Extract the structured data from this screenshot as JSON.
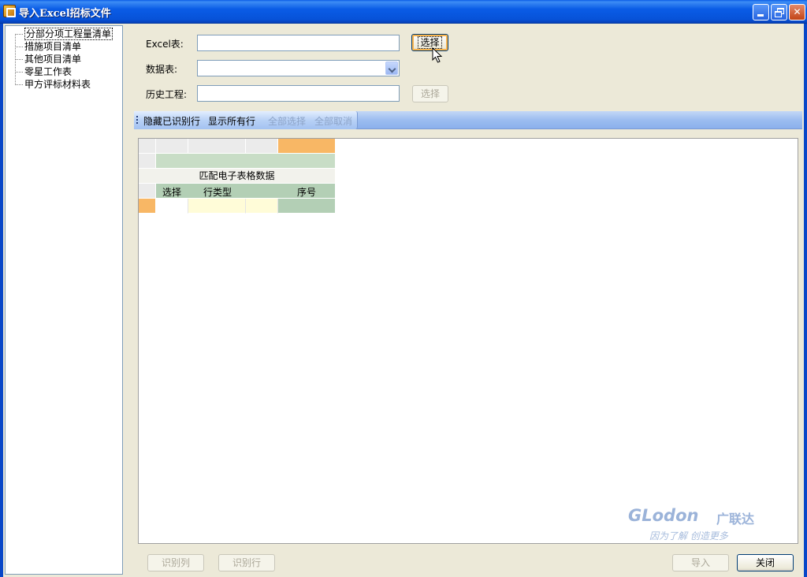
{
  "window": {
    "title": "导入Excel招标文件"
  },
  "tree": {
    "items": [
      {
        "label": "分部分项工程量清单",
        "selected": true
      },
      {
        "label": "措施项目清单"
      },
      {
        "label": "其他项目清单"
      },
      {
        "label": "零星工作表"
      },
      {
        "label": "甲方评标材料表"
      }
    ]
  },
  "form": {
    "excel_label": "Excel表:",
    "excel_value": "",
    "excel_button": "选择",
    "sheet_label": "数据表:",
    "sheet_value": "",
    "history_label": "历史工程:",
    "history_value": "",
    "history_button": "选择"
  },
  "toolbar": {
    "hide_recognized": "隐藏已识别行",
    "show_all": "显示所有行",
    "select_all": "全部选择",
    "deselect_all": "全部取消"
  },
  "grid": {
    "match_title": "匹配电子表格数据",
    "col_select": "选择",
    "col_row_type": "行类型",
    "col_index": "序号"
  },
  "logo": {
    "brand_en": "GLodon",
    "brand_cn": "广联达",
    "slogan": "因为了解 创造更多"
  },
  "footer": {
    "recognize_column": "识别列",
    "recognize_row": "识别行",
    "import": "导入",
    "close": "关闭"
  },
  "colors": {
    "titlebar": "#0a5ce6",
    "toolbar": "#9cbdf0",
    "orange_cell": "#f8b765",
    "green_cell": "#c8ddc6"
  }
}
